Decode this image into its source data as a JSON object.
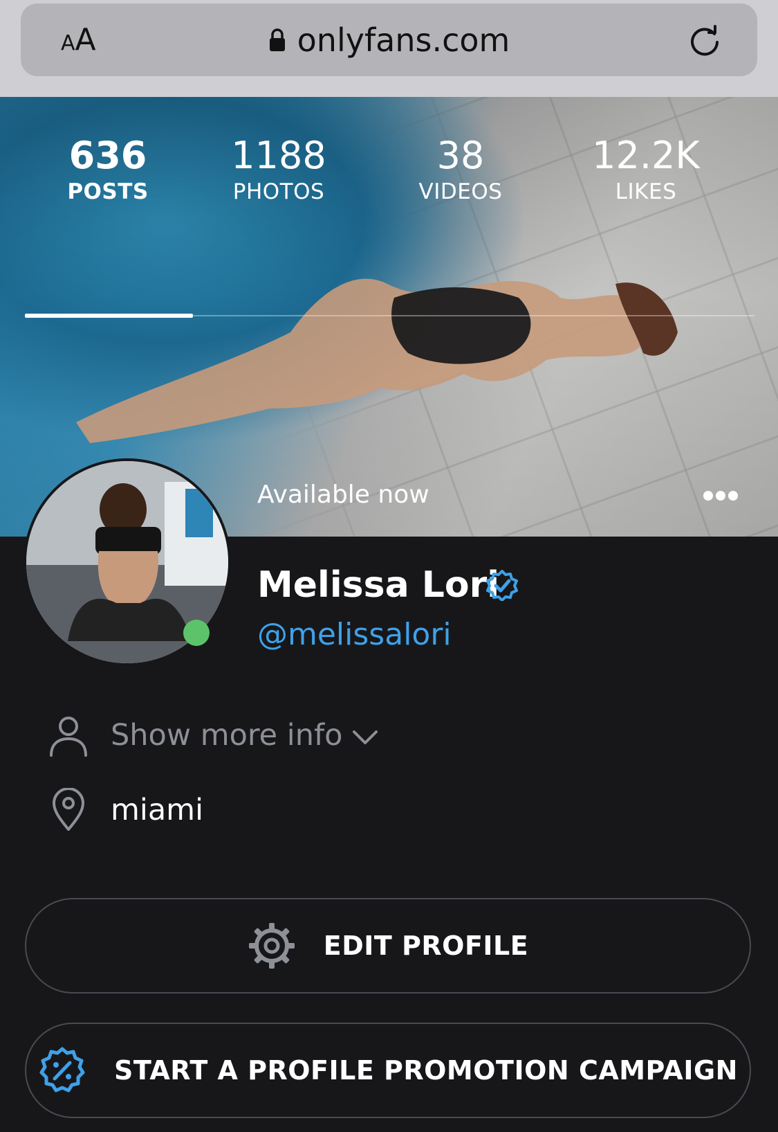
{
  "browser": {
    "aa_label": "AA",
    "host": "onlyfans.com"
  },
  "profile_stats": [
    {
      "value": "636",
      "label": "POSTS",
      "active": true
    },
    {
      "value": "1188",
      "label": "PHOTOS",
      "active": false
    },
    {
      "value": "38",
      "label": "VIDEOS",
      "active": false
    },
    {
      "value": "12.2K",
      "label": "LIKES",
      "active": false
    }
  ],
  "cover": {
    "status_text": "Available now"
  },
  "profile": {
    "name": "Melissa Lori",
    "handle": "@melissalori",
    "online": true,
    "verified": true
  },
  "info": {
    "show_more_label": "Show more info",
    "location": "miami"
  },
  "actions": {
    "edit_profile_label": "EDIT PROFILE",
    "promotion_label": "START A PROFILE PROMOTION CAMPAIGN"
  },
  "colors": {
    "background": "#17171a",
    "accent": "#3fa1e8",
    "online": "#5dc36b",
    "muted_text": "#8d9097"
  }
}
